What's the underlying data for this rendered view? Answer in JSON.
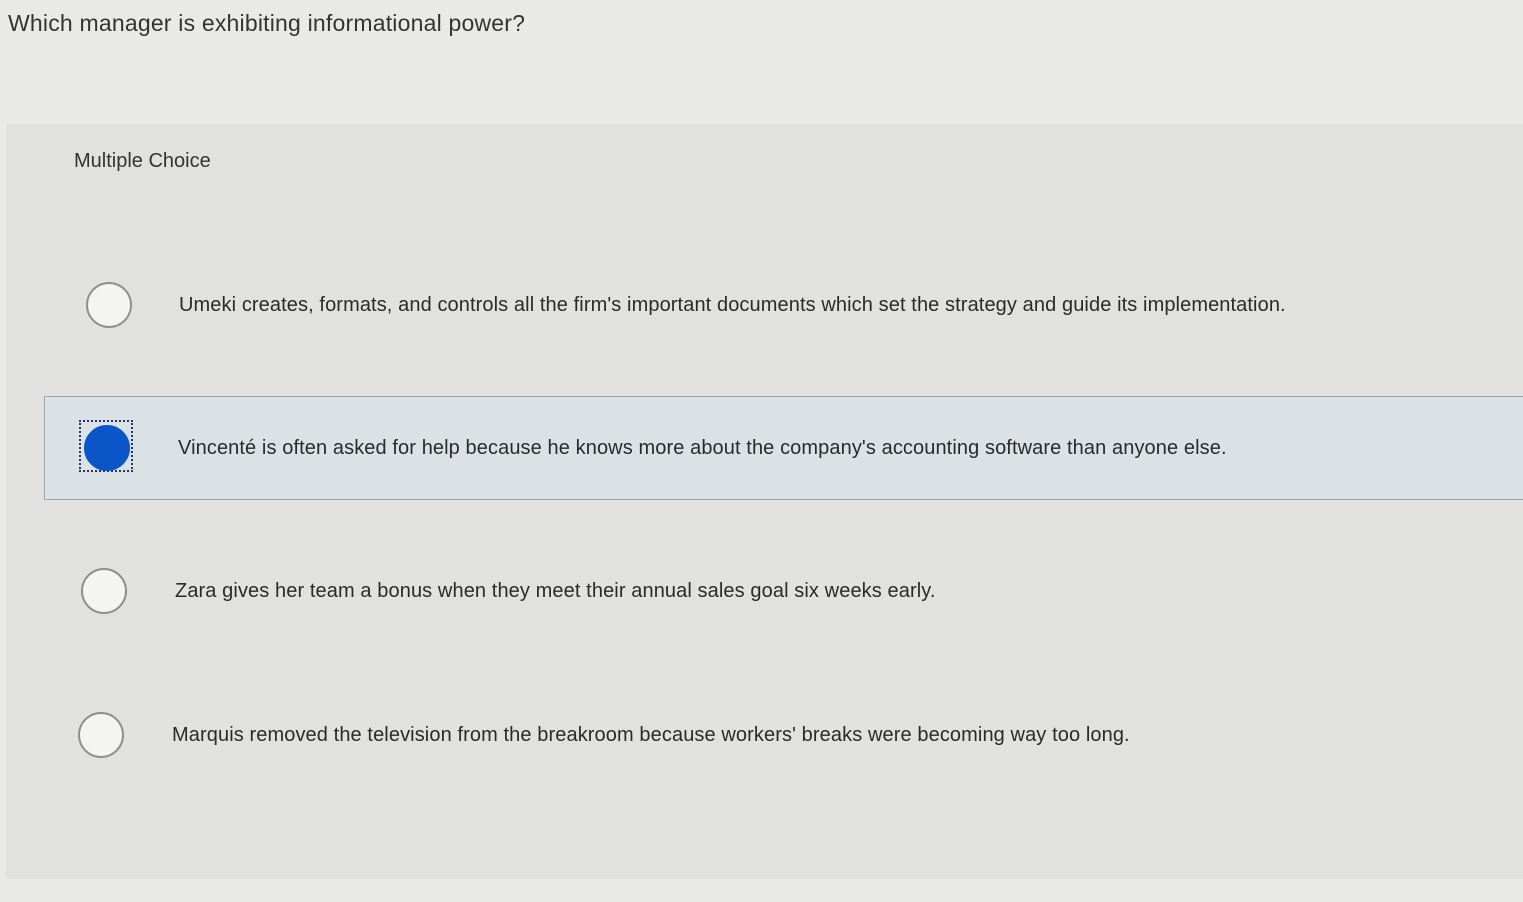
{
  "question": "Which manager is exhibiting informational power?",
  "choice_type_label": "Multiple Choice",
  "selected_index": 1,
  "colors": {
    "selected_fill": "#0a56c9",
    "selected_row_bg": "#dbe2e6"
  },
  "options": [
    {
      "text": "Umeki creates, formats, and controls all the firm's important documents which set the strategy and guide its implementation."
    },
    {
      "text": "Vincenté is often asked for help because he knows more about the company's accounting software than anyone else."
    },
    {
      "text": "Zara gives her team a bonus when they meet their annual sales goal six weeks early."
    },
    {
      "text": "Marquis removed the television from the breakroom because workers' breaks were becoming way too long."
    }
  ]
}
